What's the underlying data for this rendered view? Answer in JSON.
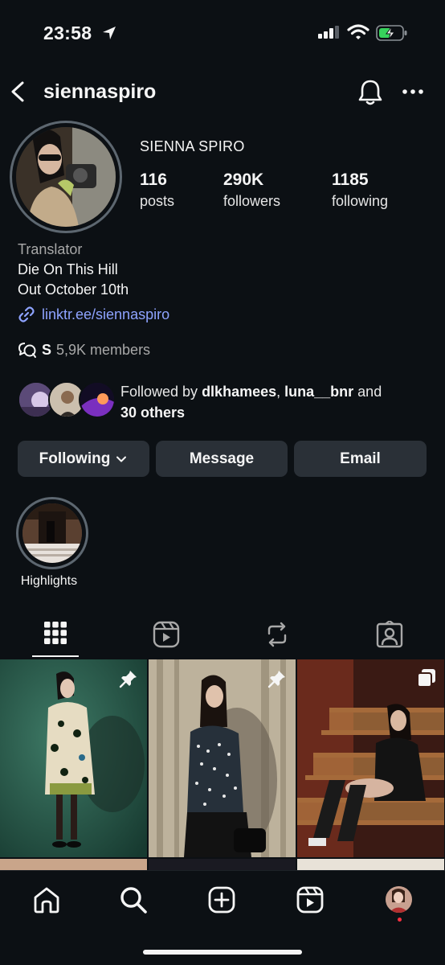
{
  "status_bar": {
    "time": "23:58"
  },
  "header": {
    "username": "siennaspiro"
  },
  "profile": {
    "full_name": "SIENNA SPIRO",
    "stats": [
      {
        "value": "116",
        "label": "posts"
      },
      {
        "value": "290K",
        "label": "followers"
      },
      {
        "value": "1185",
        "label": "following"
      }
    ],
    "category": "Translator",
    "bio_line1": "Die On This Hill",
    "bio_line2": "Out October 10th",
    "link": "linktr.ee/siennaspiro",
    "channel_letter": "S",
    "channel_members": "5,9K members"
  },
  "followed_by": {
    "prefix": "Followed by ",
    "user1": "dlkhamees",
    "separator": ", ",
    "user2": "luna__bnr",
    "conjunction": " and",
    "others": "30 others"
  },
  "actions": {
    "following": "Following",
    "message": "Message",
    "email": "Email"
  },
  "highlights": [
    {
      "label": "Highlights"
    }
  ],
  "tabs": [
    "grid-icon",
    "reels-icon",
    "reposts-icon",
    "tagged-icon"
  ],
  "posts": [
    {
      "pinned": true,
      "type": "photo"
    },
    {
      "pinned": true,
      "type": "photo"
    },
    {
      "pinned": false,
      "type": "carousel"
    }
  ],
  "nav": [
    "home-icon",
    "search-icon",
    "create-icon",
    "reels-icon",
    "profile-avatar"
  ],
  "colors": {
    "background": "#0c1014",
    "button": "#2a3037",
    "link": "#8ea3ff",
    "notification_dot": "#ff3040"
  }
}
